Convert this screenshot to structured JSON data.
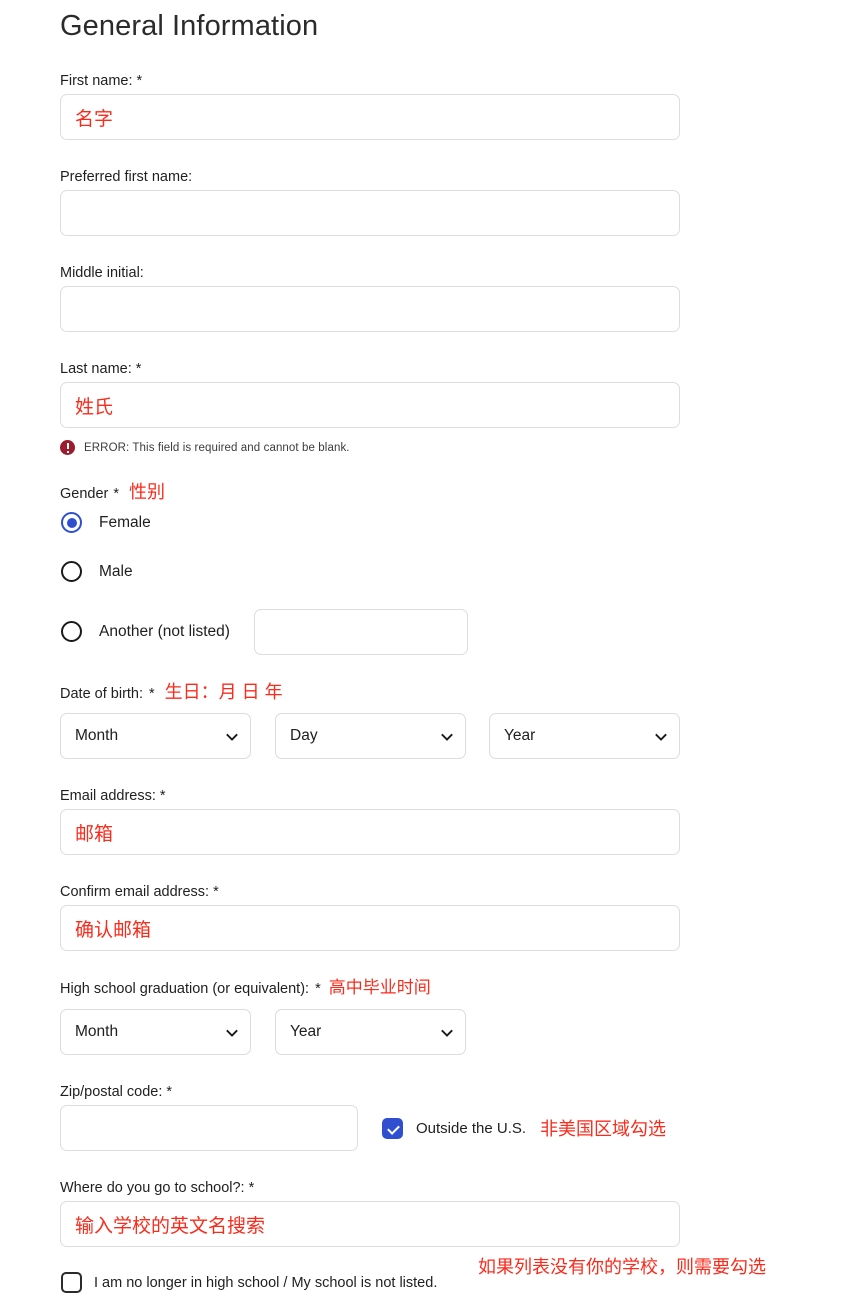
{
  "page": {
    "title": "General Information"
  },
  "accent": {
    "blue": "#2f4fd0",
    "annotation_red": "#fb2b1c",
    "error_red": "#9b1c2e",
    "border_gray": "#dddddd"
  },
  "fields": {
    "first_name": {
      "label": "First name:",
      "required_mark": "*",
      "value": "名字",
      "placeholder": ""
    },
    "preferred_first_name": {
      "label": "Preferred first name:",
      "required_mark": "",
      "value": "",
      "placeholder": ""
    },
    "middle_initial": {
      "label": "Middle initial:",
      "required_mark": "",
      "value": "",
      "placeholder": ""
    },
    "last_name": {
      "label": "Last name:",
      "required_mark": "*",
      "value": "姓氏",
      "placeholder": "",
      "error": "ERROR: This field is required and cannot be blank."
    },
    "gender": {
      "label": "Gender",
      "required_mark": "*",
      "annotation": "性别",
      "options": [
        {
          "label": "Female",
          "selected": true
        },
        {
          "label": "Male",
          "selected": false
        },
        {
          "label": "Another (not listed)",
          "selected": false
        }
      ],
      "other_value": "",
      "other_placeholder": ""
    },
    "date_of_birth": {
      "label": "Date of birth:",
      "required_mark": "*",
      "annotation": "生日：月 日 年",
      "month": "Month",
      "day": "Day",
      "year": "Year"
    },
    "email": {
      "label": "Email address:",
      "required_mark": "*",
      "value": "邮箱",
      "placeholder": ""
    },
    "confirm_email": {
      "label": "Confirm email address:",
      "required_mark": "*",
      "value": "确认邮箱",
      "placeholder": ""
    },
    "hs_graduation": {
      "label": "High school graduation (or equivalent):",
      "required_mark": "*",
      "annotation": "高中毕业时间",
      "month": "Month",
      "year": "Year"
    },
    "zip": {
      "label": "Zip/postal code:",
      "required_mark": "*",
      "value": "",
      "placeholder": "",
      "outside_us_label": "Outside the U.S.",
      "outside_us_checked": true,
      "outside_us_annotation": "非美国区域勾选"
    },
    "school": {
      "label": "Where do you go to school?:",
      "required_mark": "*",
      "value": "输入学校的英文名搜索",
      "placeholder": "",
      "not_listed_label": "I am no longer in high school / My school is not listed.",
      "not_listed_checked": false,
      "not_listed_annotation": "如果列表没有你的学校，则需要勾选"
    }
  },
  "icons": {
    "chevron_down": "chevron-down-icon",
    "error": "error-circle-icon",
    "check": "check-icon"
  }
}
